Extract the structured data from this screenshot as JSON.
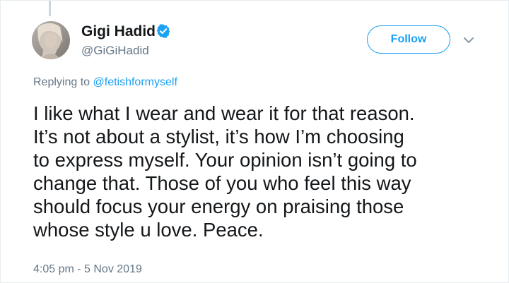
{
  "author": {
    "name": "Gigi Hadid",
    "handle": "@GiGiHadid",
    "verified": true
  },
  "follow_button": {
    "label": "Follow"
  },
  "replying": {
    "prefix": "Replying to ",
    "mention": "@fetishformyself"
  },
  "tweet": {
    "lines": [
      "I like what I wear and wear it for that reason.",
      "It’s not about a stylist, it’s how I’m choosing",
      "to express myself. Your opinion isn’t going to",
      "change that. Those of you who feel this way",
      "should focus your energy on praising those",
      "whose style u love. Peace."
    ],
    "timestamp": "4:05 pm - 5 Nov 2019"
  },
  "colors": {
    "accent": "#1da1f2",
    "text": "#14171a",
    "secondary_text": "#657786",
    "border": "#e6ecf0"
  },
  "icons": {
    "verified": "verified-badge-icon",
    "more": "chevron-down-icon"
  }
}
